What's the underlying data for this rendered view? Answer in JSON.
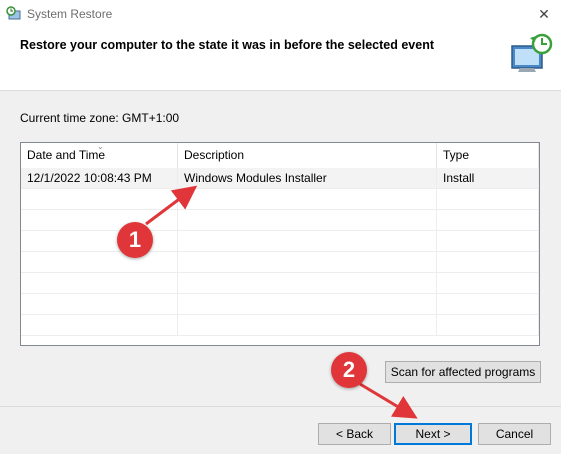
{
  "window": {
    "title": "System Restore",
    "close_glyph": "✕"
  },
  "header": {
    "title": "Restore your computer to the state it was in before the selected event"
  },
  "timezone": {
    "text": "Current time zone: GMT+1:00"
  },
  "table": {
    "columns": [
      "Date and Time",
      "Description",
      "Type"
    ],
    "rows": [
      {
        "date": "12/1/2022 10:08:43 PM",
        "description": "Windows Modules Installer",
        "type": "Install"
      }
    ]
  },
  "buttons": {
    "scan": "Scan for affected programs",
    "back": "< Back",
    "next": "Next >",
    "cancel": "Cancel"
  },
  "annotations": {
    "badge1": "1",
    "badge2": "2",
    "color": "#e0363a"
  }
}
